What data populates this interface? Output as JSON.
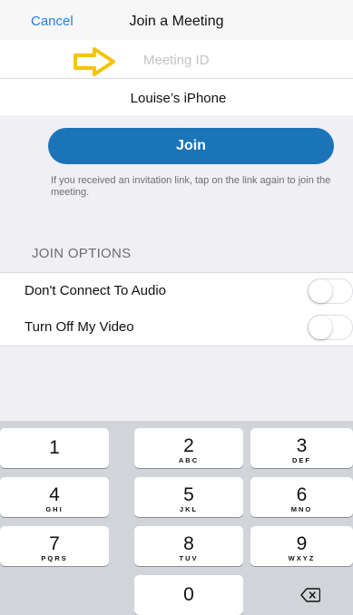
{
  "nav": {
    "cancel_label": "Cancel",
    "title": "Join a Meeting"
  },
  "meeting_id": {
    "placeholder": "Meeting ID",
    "value": ""
  },
  "device_name": {
    "value": "Louise’s iPhone"
  },
  "join": {
    "label": "Join",
    "hint": "If you received an invitation link, tap on the link again to join the meeting."
  },
  "options": {
    "header": "JOIN OPTIONS",
    "items": [
      {
        "label": "Don't Connect To Audio",
        "on": false
      },
      {
        "label": "Turn Off My Video",
        "on": false
      }
    ]
  },
  "keypad": {
    "keys": [
      {
        "num": "1",
        "letters": ""
      },
      {
        "num": "2",
        "letters": "ABC"
      },
      {
        "num": "3",
        "letters": "DEF"
      },
      {
        "num": "4",
        "letters": "GHI"
      },
      {
        "num": "5",
        "letters": "JKL"
      },
      {
        "num": "6",
        "letters": "MNO"
      },
      {
        "num": "7",
        "letters": "PQRS"
      },
      {
        "num": "8",
        "letters": "TUV"
      },
      {
        "num": "9",
        "letters": "WXYZ"
      },
      {
        "num": "0",
        "letters": ""
      }
    ],
    "delete_icon": "backspace-icon"
  },
  "colors": {
    "accent": "#2a7de1",
    "join_button": "#1b73b8",
    "annotation_arrow": "#f5c400",
    "background": "#efeff4"
  }
}
